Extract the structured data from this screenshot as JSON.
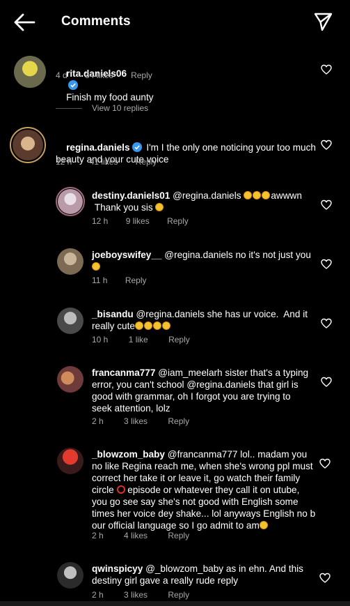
{
  "header": {
    "title": "Comments",
    "back_icon": "arrow-left-icon",
    "send_icon": "paper-plane-icon"
  },
  "comments": [
    {
      "username": "rita.daniels06",
      "verified": true,
      "text": "Finish my food aunty",
      "time": "4 d",
      "likes": "34 likes",
      "reply": "Reply"
    },
    {
      "view_replies": "View 10 replies"
    },
    {
      "username": "regina.daniels",
      "verified": true,
      "text": "I'm I the only one noticing your too much beauty and your cute voice",
      "time": "12 h",
      "likes": "41 likes",
      "reply": "Reply"
    }
  ],
  "replies": [
    {
      "username": "destiny.daniels01",
      "text_a": "@regina.daniels",
      "text_b": "awwwn",
      "text_c": "Thank you sis",
      "time": "12 h",
      "likes": "9 likes",
      "reply": "Reply"
    },
    {
      "username": "joeboyswifey__",
      "text": "@regina.daniels no it's not just you",
      "time": "11 h",
      "reply": "Reply"
    },
    {
      "username": "_bisandu",
      "text_a": "@regina.daniels she has ur voice.  And it",
      "text_b": "really cute",
      "time": "10 h",
      "likes": "1 like",
      "reply": "Reply"
    },
    {
      "username": "francanma777",
      "text_a": "@iam_meelarh sister that's a typing",
      "text_b": "error, you can't school @regina.daniels that girl is",
      "text_c": "good with grammar, oh I forgot you are trying to",
      "text_d": "seek attention, lolz",
      "time": "2 h",
      "likes": "3 likes",
      "reply": "Reply"
    },
    {
      "username": "_blowzom_baby",
      "text_a": "@francanma777 lol.. madam you",
      "text_b": "no like Regina reach me, when she's wrong ppl must",
      "text_c": "correct her take it or leave it, go watch their family",
      "text_d1": "circle",
      "text_d2": " episode or whatever they call it on utube,",
      "text_e": "you go see say she's not good with English some",
      "text_f": "times her voice dey shake... lol anyways English no b",
      "text_g": "our official language so I go admit to am",
      "time": "2 h",
      "likes": "4 likes",
      "reply": "Reply"
    },
    {
      "username": "qwinspicyy",
      "text_a": "@_blowzom_baby as in ehn. And this",
      "text_b": "destiny girl gave a really rude reply",
      "time": "2 h",
      "likes": "3 likes",
      "reply": "Reply"
    }
  ],
  "colors": {
    "background": "#000000",
    "meta": "#a8a8a8",
    "verified": "#3897f0",
    "emoji": "#f2c230"
  }
}
